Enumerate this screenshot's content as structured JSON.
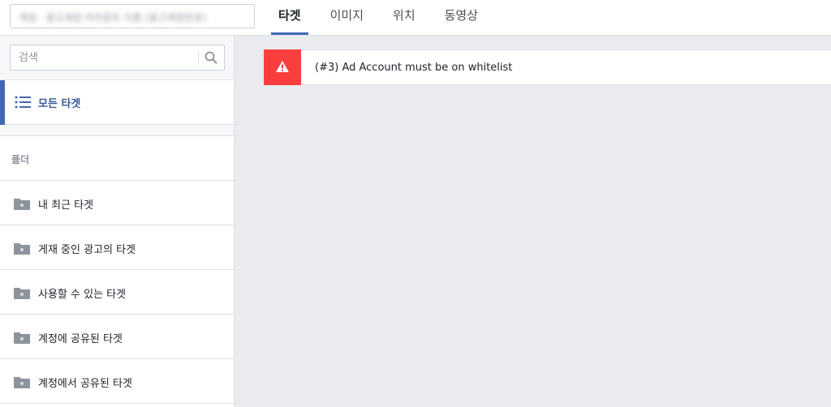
{
  "header": {
    "account_selector_text": "계정 · 광고계정 어카운트 이름 (광고계정번호)",
    "tabs": [
      {
        "label": "타겟"
      },
      {
        "label": "이미지"
      },
      {
        "label": "위치"
      },
      {
        "label": "동영상"
      }
    ],
    "active_tab": "타겟"
  },
  "sidebar": {
    "search": {
      "placeholder": "검색",
      "value": ""
    },
    "all_targets_label": "모든 타겟",
    "folder_header": "폴더",
    "folders": [
      {
        "label": "내 최근 타겟"
      },
      {
        "label": "게재 중인 광고의 타겟"
      },
      {
        "label": "사용할 수 있는 타겟"
      },
      {
        "label": "계정에 공유된 타겟"
      },
      {
        "label": "계정에서 공유된 타겟"
      }
    ]
  },
  "main": {
    "error_message": "(#3) Ad Account must be on whitelist"
  },
  "colors": {
    "accent": "#4267b2",
    "link": "#365899",
    "error": "#fa3e3e",
    "background": "#e9ebee"
  },
  "icons": {
    "search": "search-icon",
    "list": "list-icon",
    "folder": "folder-icon",
    "warning": "warning-icon"
  }
}
